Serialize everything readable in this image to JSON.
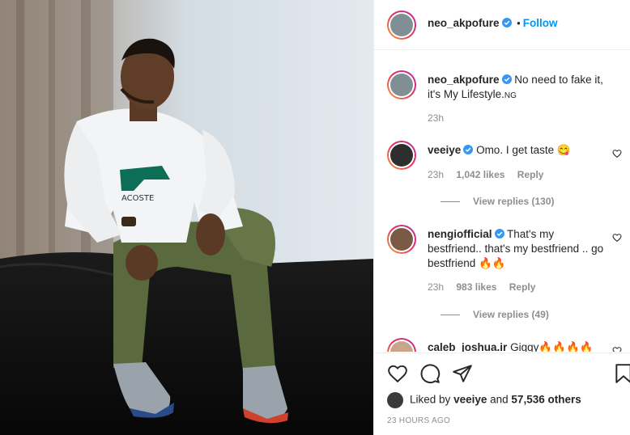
{
  "header": {
    "username": "neo_akpofure",
    "follow_label": "Follow"
  },
  "caption": {
    "username": "neo_akpofure",
    "text": "No need to fake it, it's My Lifestyle.",
    "suffix": "NG",
    "time": "23h"
  },
  "comments": [
    {
      "username": "veeiye",
      "text": "Omo. I get taste 😋",
      "time": "23h",
      "likes": "1,042 likes",
      "reply_label": "Reply",
      "view_replies": "View replies (130)"
    },
    {
      "username": "nengiofficial",
      "text": "That's my bestfriend.. that's my bestfriend .. go bestfriend 🔥🔥",
      "time": "23h",
      "likes": "983 likes",
      "reply_label": "Reply",
      "view_replies": "View replies (49)"
    },
    {
      "username": "caleb_joshua.ir",
      "text": "Giggy🔥🔥🔥🔥"
    }
  ],
  "actions": {
    "liked_by_prefix": "Liked by",
    "liked_by_user": "veeiye",
    "liked_by_and": "and",
    "liked_by_others": "57,536 others",
    "timestamp": "23 HOURS AGO"
  },
  "icons": {
    "verified": "verified-badge-icon",
    "like": "heart-icon",
    "comment": "comment-icon",
    "share": "paper-plane-icon",
    "save": "bookmark-icon"
  },
  "colors": {
    "link": "#0095f6",
    "muted": "#8e8e8e",
    "text": "#262626",
    "border": "#efefef"
  }
}
